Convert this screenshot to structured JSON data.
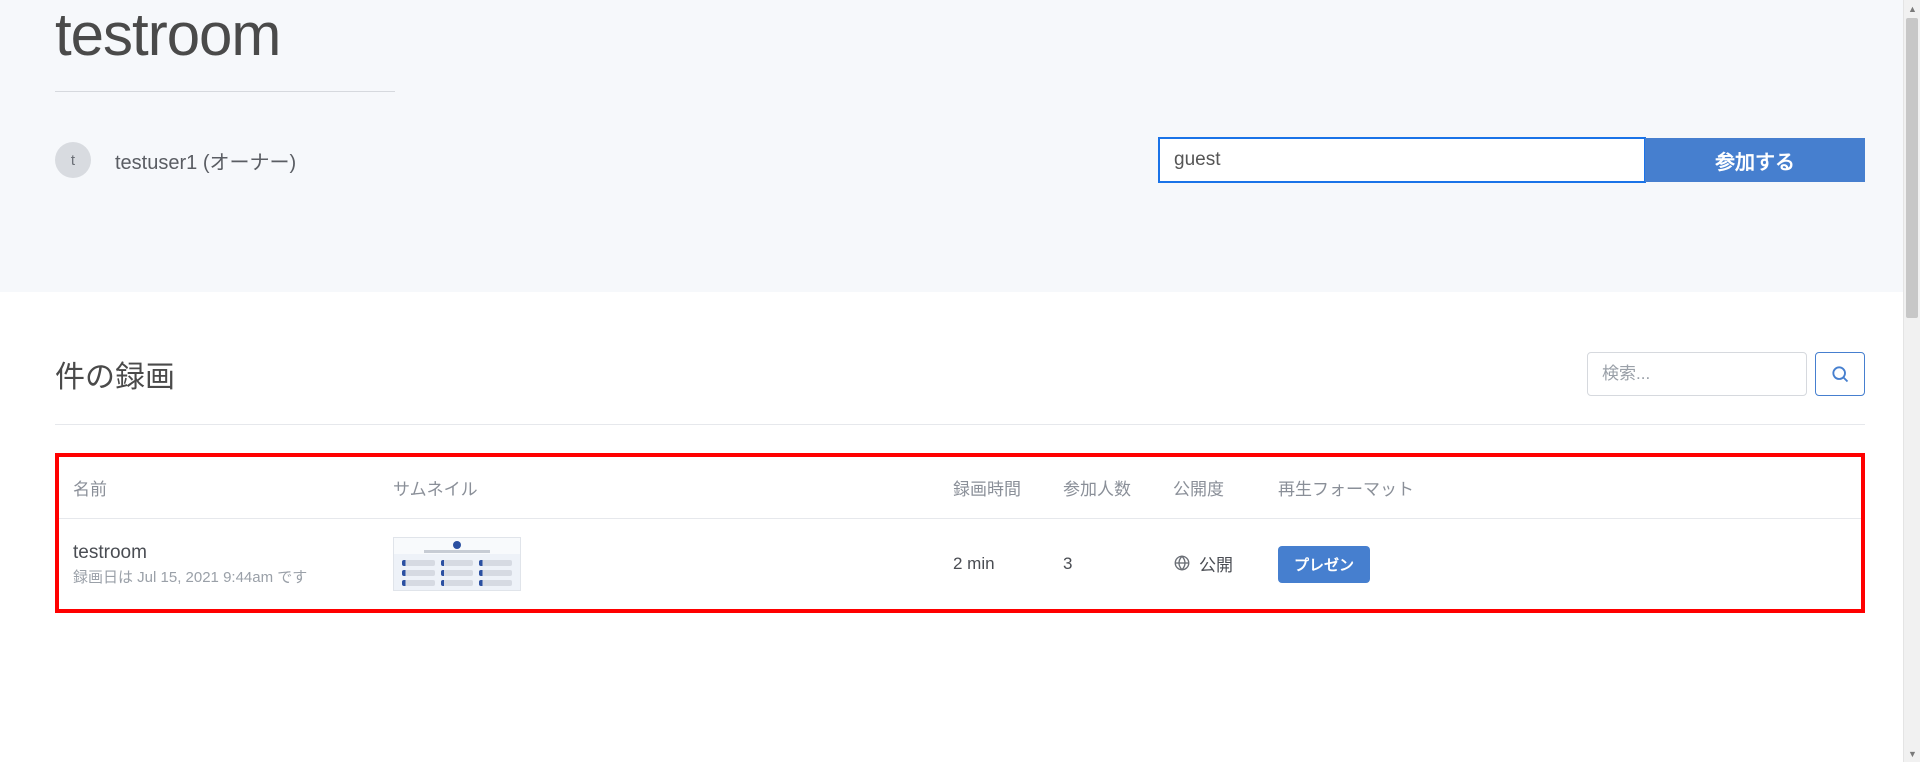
{
  "header": {
    "title": "testroom",
    "owner_avatar_initial": "t",
    "owner_label": "testuser1 (オーナー)"
  },
  "join": {
    "input_value": "guest",
    "button_label": "参加する"
  },
  "records": {
    "section_title": "件の録画",
    "search_placeholder": "検索...",
    "columns": {
      "name": "名前",
      "thumbnail": "サムネイル",
      "duration": "録画時間",
      "attendees": "参加人数",
      "visibility": "公開度",
      "format": "再生フォーマット"
    },
    "rows": [
      {
        "name": "testroom",
        "date_line": "録画日は Jul 15, 2021 9:44am です",
        "duration": "2 min",
        "attendees": "3",
        "visibility": "公開",
        "format_label": "プレゼン"
      }
    ]
  }
}
